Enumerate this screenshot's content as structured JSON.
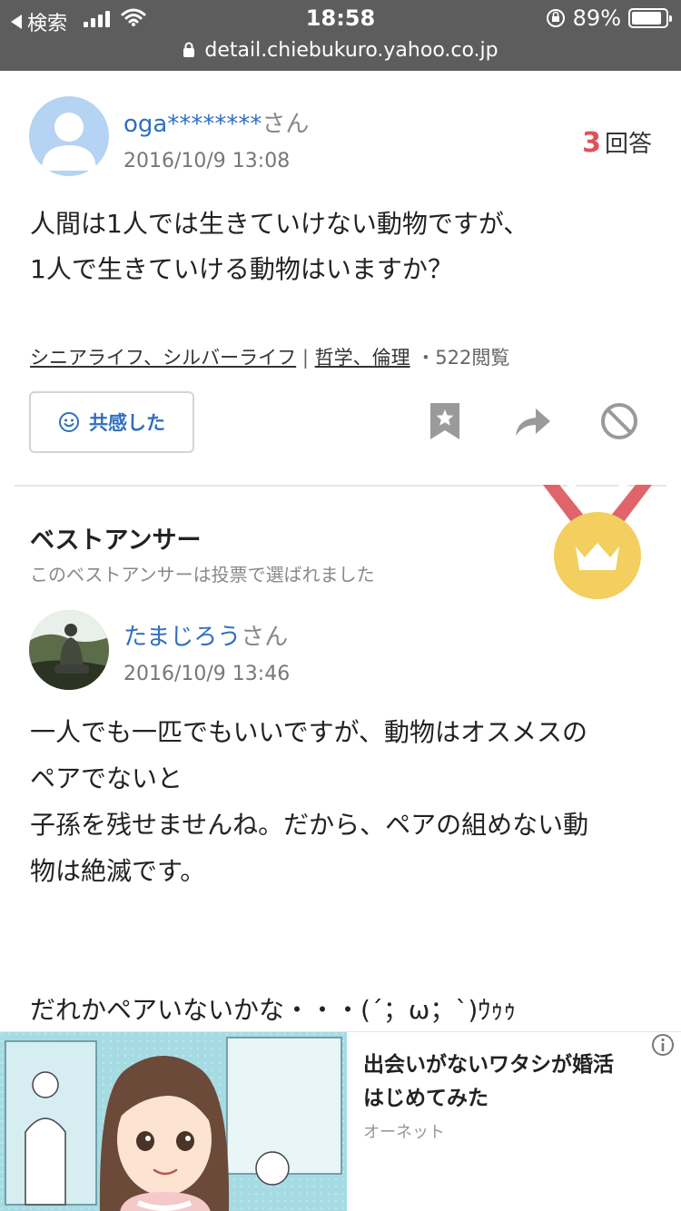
{
  "status_bar": {
    "back_label": "検索",
    "time": "18:58",
    "battery": "89%",
    "battery_level": 0.89
  },
  "url_bar": {
    "domain": "detail.chiebukuro.yahoo.co.jp"
  },
  "question": {
    "user": "oga********",
    "honorific": "さん",
    "date": "2016/10/9 13:08",
    "answer_count": "3",
    "answer_label": "回答",
    "body_line1": "人間は1人では生きていけない動物ですが、",
    "body_line2": "1人で生きていける動物はいますか？",
    "category1": "シニアライフ、シルバーライフ",
    "category2": "哲学、倫理",
    "separator": "|",
    "views": "・522閲覧",
    "empathy_label": "共感した"
  },
  "best_answer": {
    "title": "ベストアンサー",
    "subtitle": "このベストアンサーは投票で選ばれました",
    "user": "たまじろう",
    "honorific": "さん",
    "date": "2016/10/9 13:46",
    "line1": "一人でも一匹でもいいですが、動物はオスメスの",
    "line2": "ペアでないと",
    "line3": "子孫を残せませんね。だから、ペアの組めない動",
    "line4": "物は絶滅です。",
    "line5": "だれかペアいないかな・・・(´；ω；`)ｳｩｩ"
  },
  "ad": {
    "title_line1": "出会いがないワタシが婚活",
    "title_line2": "はじめてみた",
    "source": "オーネット"
  },
  "colors": {
    "link": "#2f6fc0",
    "answer_count": "#e15057",
    "medal_gold": "#f2cf5e",
    "ribbon": "#e0646b"
  },
  "icons": [
    "back-arrow-icon",
    "signal-icon",
    "wifi-icon",
    "orientation-lock-icon",
    "battery-icon",
    "lock-icon",
    "smile-icon",
    "bookmark-icon",
    "share-icon",
    "block-icon",
    "medal-icon",
    "crown-icon",
    "info-icon"
  ]
}
